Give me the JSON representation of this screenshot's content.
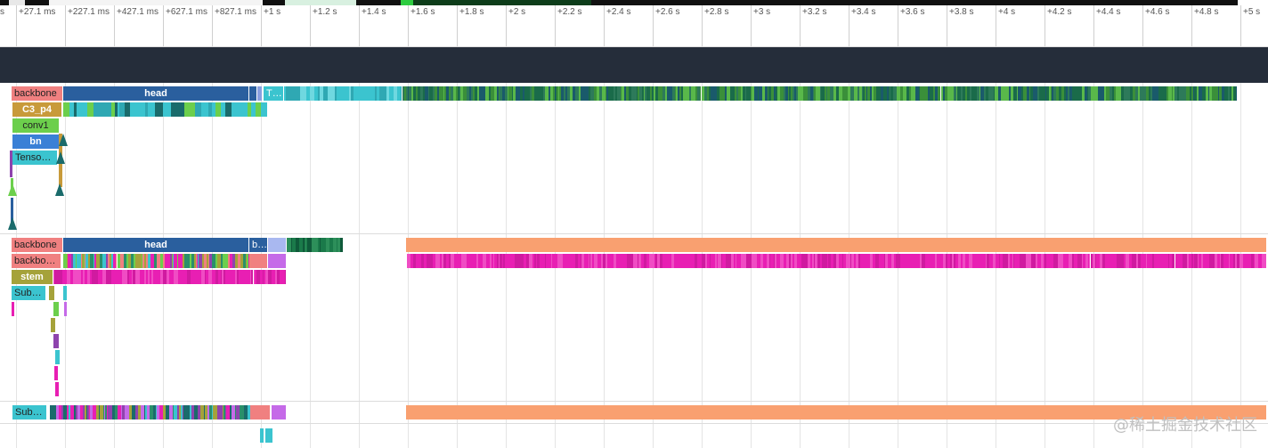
{
  "ruler": {
    "ticks": [
      "s",
      "+27.1 ms",
      "+227.1 ms",
      "+427.1 ms",
      "+627.1 ms",
      "+827.1 ms",
      "+1 s",
      "+1.2 s",
      "+1.4 s",
      "+1.6 s",
      "+1.8 s",
      "+2 s",
      "+2.2 s",
      "+2.4 s",
      "+2.6 s",
      "+2.8 s",
      "+3 s",
      "+3.2 s",
      "+3.4 s",
      "+3.6 s",
      "+3.8 s",
      "+4 s",
      "+4.2 s",
      "+4.4 s",
      "+4.6 s",
      "+4.8 s",
      "+5 s"
    ]
  },
  "track1": {
    "backbone": "backbone",
    "head": "head",
    "t_label": "T…",
    "c3_p4": "C3_p4",
    "conv1": "conv1",
    "bn": "bn",
    "tensor": "Tensor…"
  },
  "track2": {
    "backbone": "backbone",
    "head": "head",
    "b_label": "b…",
    "backbo": "backbo…",
    "stem": "stem",
    "subt": "Subt…"
  },
  "track3": {
    "subt": "Subt…"
  },
  "colors": {
    "backbone": "#f08080",
    "head": "#2a5f9e",
    "teal": "#3bc4cf",
    "green": "#3a8f3a",
    "orange": "#f9a070",
    "magenta": "#e81fb3",
    "olive": "#a5a23a",
    "conv1": "#6ccf4c",
    "bn": "#3a80d6"
  },
  "watermark": "@稀土掘金技术社区"
}
